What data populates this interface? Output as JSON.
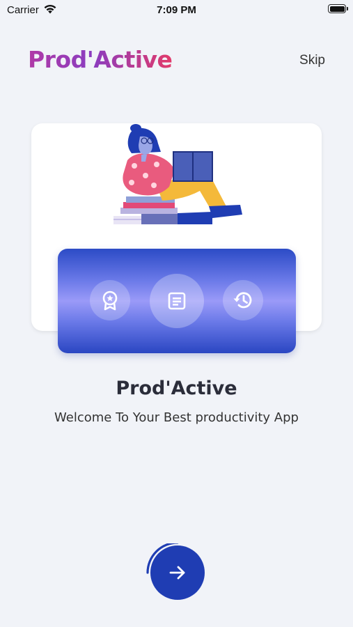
{
  "status_bar": {
    "carrier": "Carrier",
    "time": "7:09 PM"
  },
  "header": {
    "logo": "Prod'Active",
    "skip_label": "Skip"
  },
  "feature_bar": {
    "items": [
      {
        "icon": "award-badge-icon"
      },
      {
        "icon": "article-icon"
      },
      {
        "icon": "history-icon"
      }
    ]
  },
  "content": {
    "title": "Prod'Active",
    "subtitle": "Welcome To Your Best productivity App"
  },
  "next_button": {
    "icon": "arrow-right-icon",
    "progress_fraction": 0.25
  },
  "colors": {
    "background": "#f1f3f8",
    "primary": "#1f3db3",
    "logo_gradient_start": "#b03aa6",
    "logo_gradient_end": "#e23a6a"
  }
}
